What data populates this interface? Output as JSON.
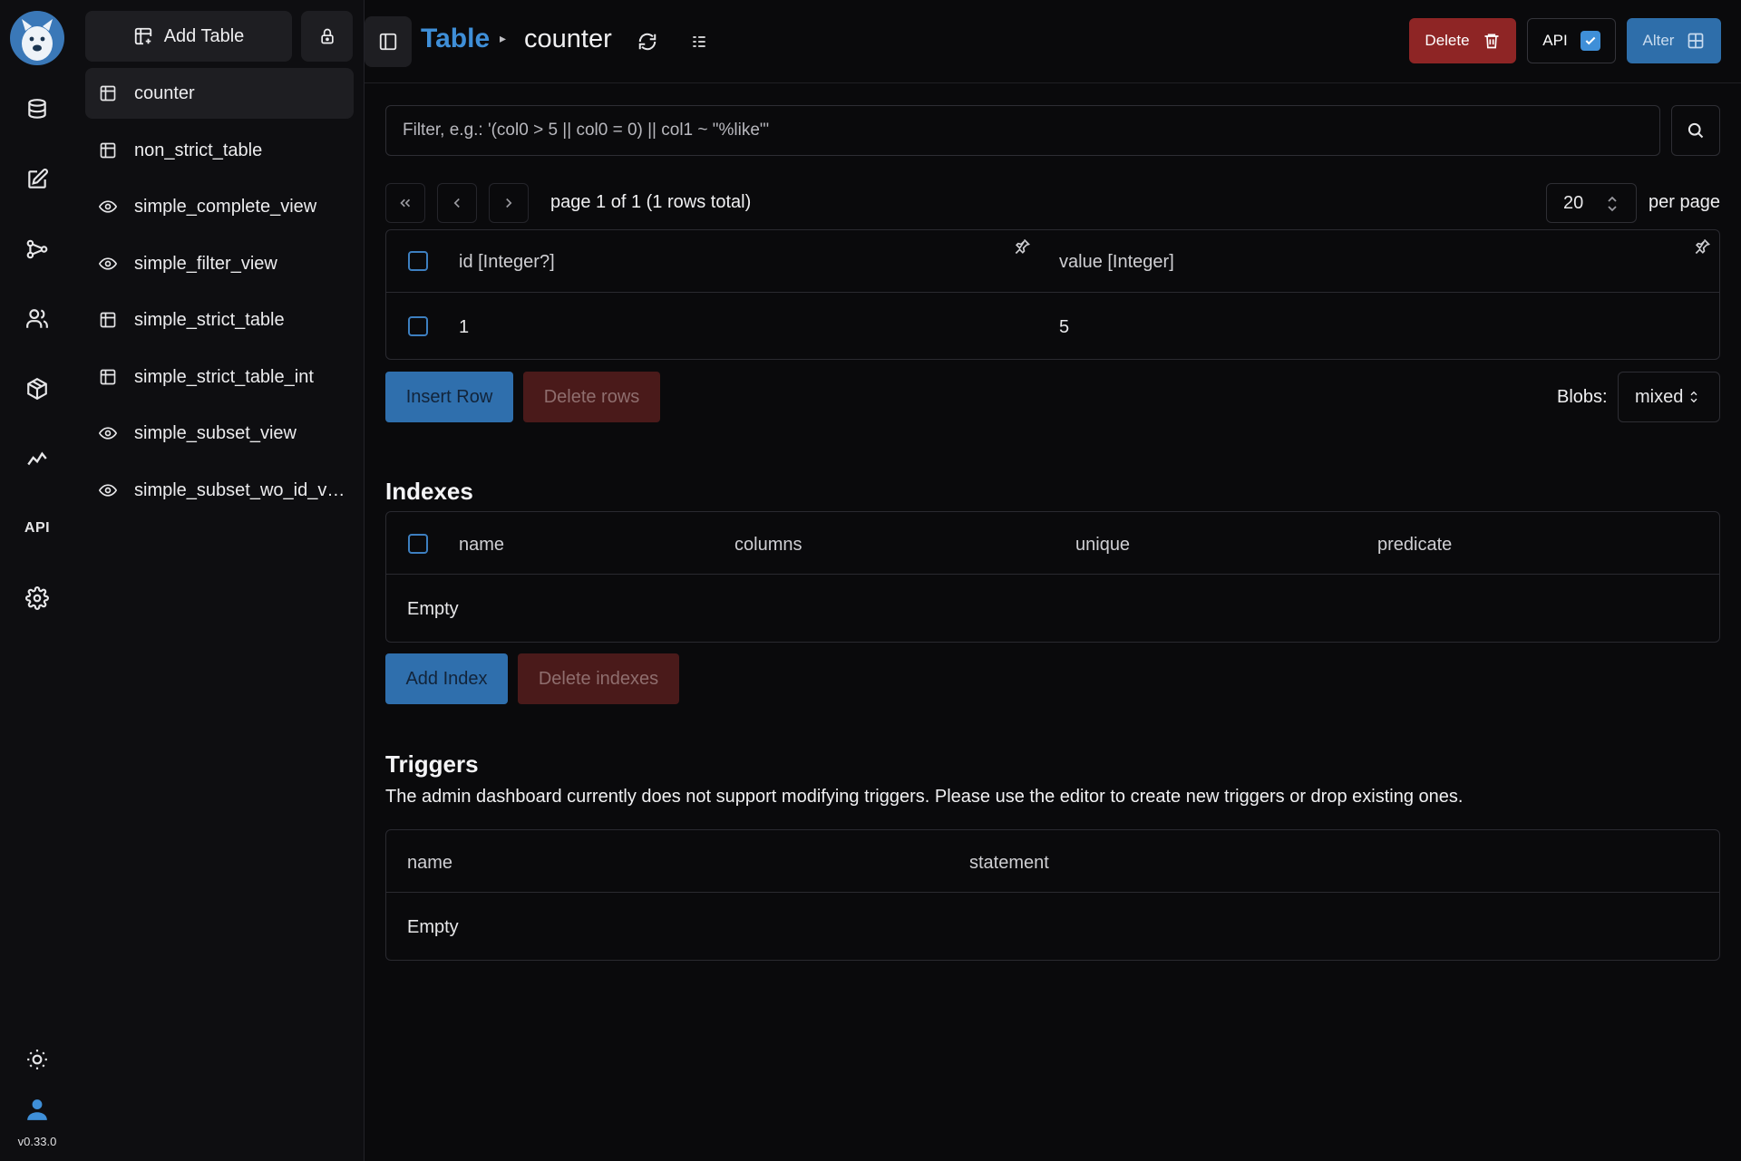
{
  "app": {
    "version": "v0.33.0",
    "rail": [
      "database-icon",
      "edit-icon",
      "graph-icon",
      "users-icon",
      "package-icon",
      "activity-icon",
      "api-text",
      "settings-icon",
      "sun-icon",
      "user-icon"
    ],
    "rail_api_label": "API"
  },
  "sidebar": {
    "add_table_label": "Add Table",
    "items": [
      {
        "label": "counter",
        "icon": "table-icon",
        "active": true
      },
      {
        "label": "non_strict_table",
        "icon": "table-icon"
      },
      {
        "label": "simple_complete_view",
        "icon": "eye-icon"
      },
      {
        "label": "simple_filter_view",
        "icon": "eye-icon"
      },
      {
        "label": "simple_strict_table",
        "icon": "table-icon"
      },
      {
        "label": "simple_strict_table_int",
        "icon": "table-icon"
      },
      {
        "label": "simple_subset_view",
        "icon": "eye-icon"
      },
      {
        "label": "simple_subset_wo_id_vi…",
        "icon": "eye-icon"
      }
    ]
  },
  "header": {
    "breadcrumb_root": "Table",
    "breadcrumb_sep": "▸",
    "table_name": "counter",
    "delete_label": "Delete",
    "api_label": "API",
    "alter_label": "Alter"
  },
  "colors": {
    "accent": "#3f8fd8",
    "danger": "#8e2525",
    "primary_button": "#2f6fad"
  },
  "filter": {
    "placeholder": "Filter, e.g.: '(col0 > 5 || col0 = 0) || col1 ~ \"%like\"'"
  },
  "pagination": {
    "text": "page 1 of 1 (1 rows total)",
    "per_page_value": "20",
    "per_page_label": "per page"
  },
  "records": {
    "columns": [
      "id [Integer?]",
      "value [Integer]"
    ],
    "rows": [
      [
        "1",
        "5"
      ]
    ],
    "insert_label": "Insert Row",
    "delete_label": "Delete rows",
    "blobs_label": "Blobs:",
    "blobs_value": "mixed"
  },
  "indexes": {
    "title": "Indexes",
    "columns": [
      "name",
      "columns",
      "unique",
      "predicate"
    ],
    "empty": "Empty",
    "add_label": "Add Index",
    "delete_label": "Delete indexes"
  },
  "triggers": {
    "title": "Triggers",
    "note": "The admin dashboard currently does not support modifying triggers. Please use the editor to create new triggers or drop existing ones.",
    "columns": [
      "name",
      "statement"
    ],
    "empty": "Empty"
  }
}
